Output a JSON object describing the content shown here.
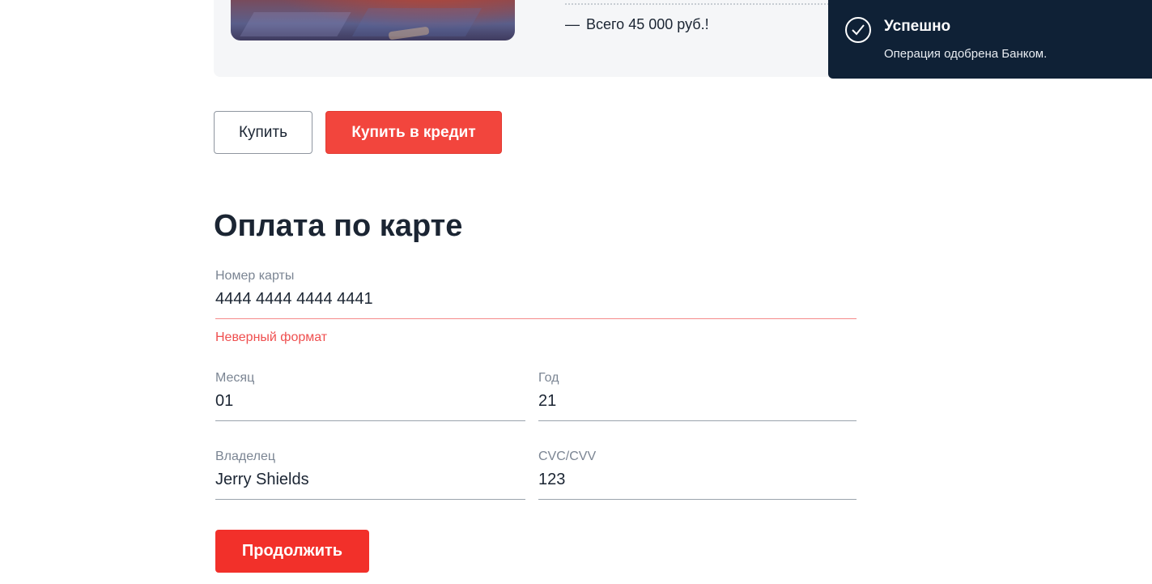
{
  "product": {
    "price_text": "Всего 45 000 руб.!",
    "price_dash": "—"
  },
  "actions": {
    "buy_label": "Купить",
    "buy_credit_label": "Купить в кредит"
  },
  "payment_form": {
    "title": "Оплата по карте",
    "card_number": {
      "label": "Номер карты",
      "value": "4444 4444 4444 4441",
      "error": "Неверный формат"
    },
    "month": {
      "label": "Месяц",
      "value": "01"
    },
    "year": {
      "label": "Год",
      "value": "21"
    },
    "owner": {
      "label": "Владелец",
      "value": "Jerry Shields"
    },
    "cvc": {
      "label": "CVC/CVV",
      "value": "123"
    },
    "continue_label": "Продолжить"
  },
  "notification": {
    "title": "Успешно",
    "message": "Операция одобрена Банком.",
    "icon": "check-circle-icon"
  },
  "colors": {
    "accent_red": "#f2453d",
    "toast_bg": "#0f2136",
    "error_red": "#ef4f4f"
  }
}
